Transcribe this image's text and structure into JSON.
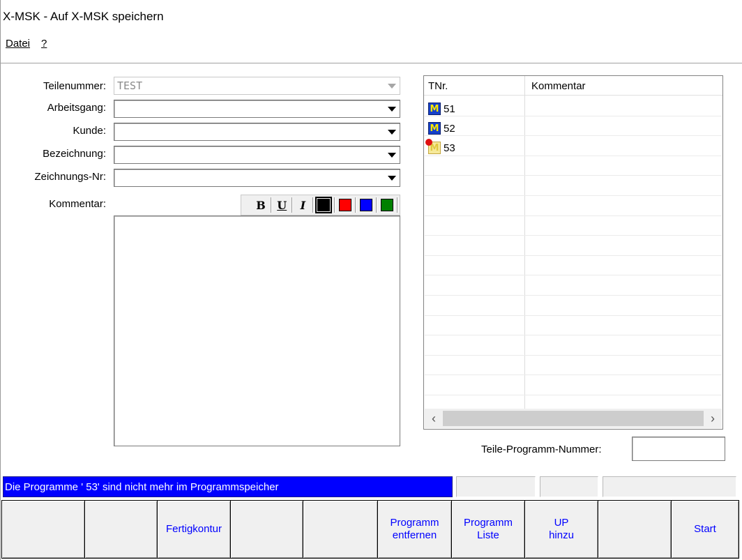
{
  "window": {
    "title": "X-MSK - Auf X-MSK speichern"
  },
  "menu": [
    {
      "label": "Datei"
    },
    {
      "label": "?"
    }
  ],
  "form": {
    "teilenummer": {
      "label": "Teilenummer:",
      "value": "TEST"
    },
    "arbeitsgang": {
      "label": "Arbeitsgang:",
      "value": ""
    },
    "kunde": {
      "label": "Kunde:",
      "value": ""
    },
    "bezeichnung": {
      "label": "Bezeichnung:",
      "value": ""
    },
    "zeichnungsnr": {
      "label": "Zeichnungs-Nr:",
      "value": ""
    },
    "kommentar": {
      "label": "Kommentar:",
      "value": ""
    }
  },
  "format_toolbar": {
    "bold": "B",
    "underline": "U",
    "italic": "I",
    "colors": [
      "#000000",
      "#ff0000",
      "#0000ff",
      "#008000"
    ]
  },
  "program_list": {
    "columns": [
      "TNr.",
      "Kommentar"
    ],
    "items": [
      {
        "tnr": "51",
        "kommentar": "",
        "icon": "m-program-icon",
        "state": "present"
      },
      {
        "tnr": "52",
        "kommentar": "",
        "icon": "m-program-icon",
        "state": "present"
      },
      {
        "tnr": "53",
        "kommentar": "",
        "icon": "m-program-icon",
        "state": "missing"
      }
    ],
    "icon_glyph": "M"
  },
  "teile_programm": {
    "label": "Teile-Programm-Nummer:",
    "value": ""
  },
  "status": {
    "message": "Die Programme ' 53' sind nicht mehr im Programmspeicher"
  },
  "softkeys": [
    {
      "label": ""
    },
    {
      "label": ""
    },
    {
      "label": "Fertigkontur"
    },
    {
      "label": ""
    },
    {
      "label": ""
    },
    {
      "label": "Programm\nentfernen"
    },
    {
      "label": "Programm\nListe"
    },
    {
      "label": "UP\nhinzu"
    },
    {
      "label": ""
    },
    {
      "label": "Start"
    }
  ],
  "colors": {
    "status_bg": "#0000ff",
    "softkey_text": "#0000ff",
    "icon_bg": "#1540c8",
    "icon_letter": "#f7e600",
    "missing_marker": "#e01010"
  }
}
